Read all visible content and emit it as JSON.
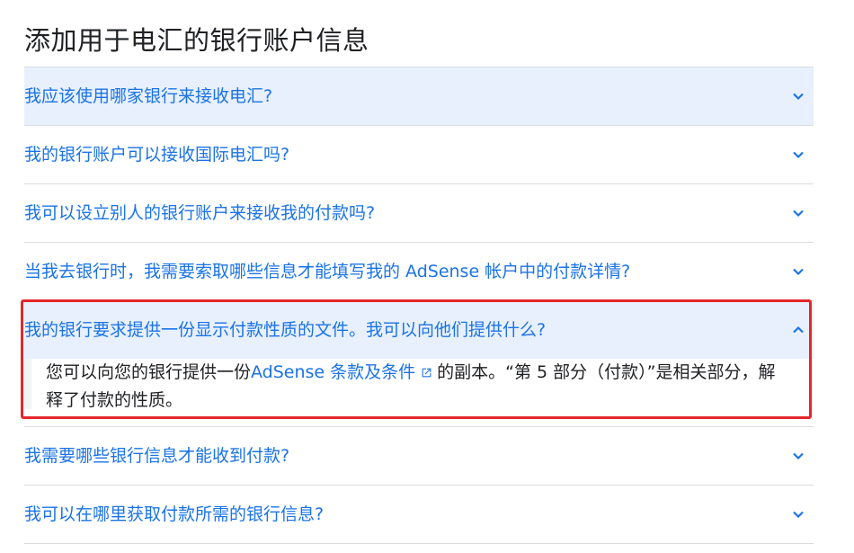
{
  "page_title": "添加用于电汇的银行账户信息",
  "colors": {
    "link": "#1a73e8",
    "highlight_bg": "#e8f0fe",
    "annotation": "#e5262b"
  },
  "faq": [
    {
      "question": "我应该使用哪家银行来接收电汇?",
      "expanded": false
    },
    {
      "question": "我的银行账户可以接收国际电汇吗?",
      "expanded": false
    },
    {
      "question": "我可以设立别人的银行账户来接收我的付款吗?",
      "expanded": false
    },
    {
      "question": "当我去银行时，我需要索取哪些信息才能填写我的 AdSense 帐户中的付款详情?",
      "expanded": false
    },
    {
      "question": "我的银行要求提供一份显示付款性质的文件。我可以向他们提供什么?",
      "expanded": true,
      "answer": {
        "before_link": "您可以向您的银行提供一份",
        "link_text": "AdSense 条款及条件",
        "after_link": "的副本。“第 5 部分（付款）”是相关部分，解释了付款的性质。"
      }
    },
    {
      "question": "我需要哪些银行信息才能收到付款?",
      "expanded": false
    },
    {
      "question": "我可以在哪里获取付款所需的银行信息?",
      "expanded": false
    }
  ],
  "icons": {
    "collapsed": "chevron-down-icon",
    "expanded": "chevron-up-icon",
    "external_link": "external-link-icon"
  }
}
